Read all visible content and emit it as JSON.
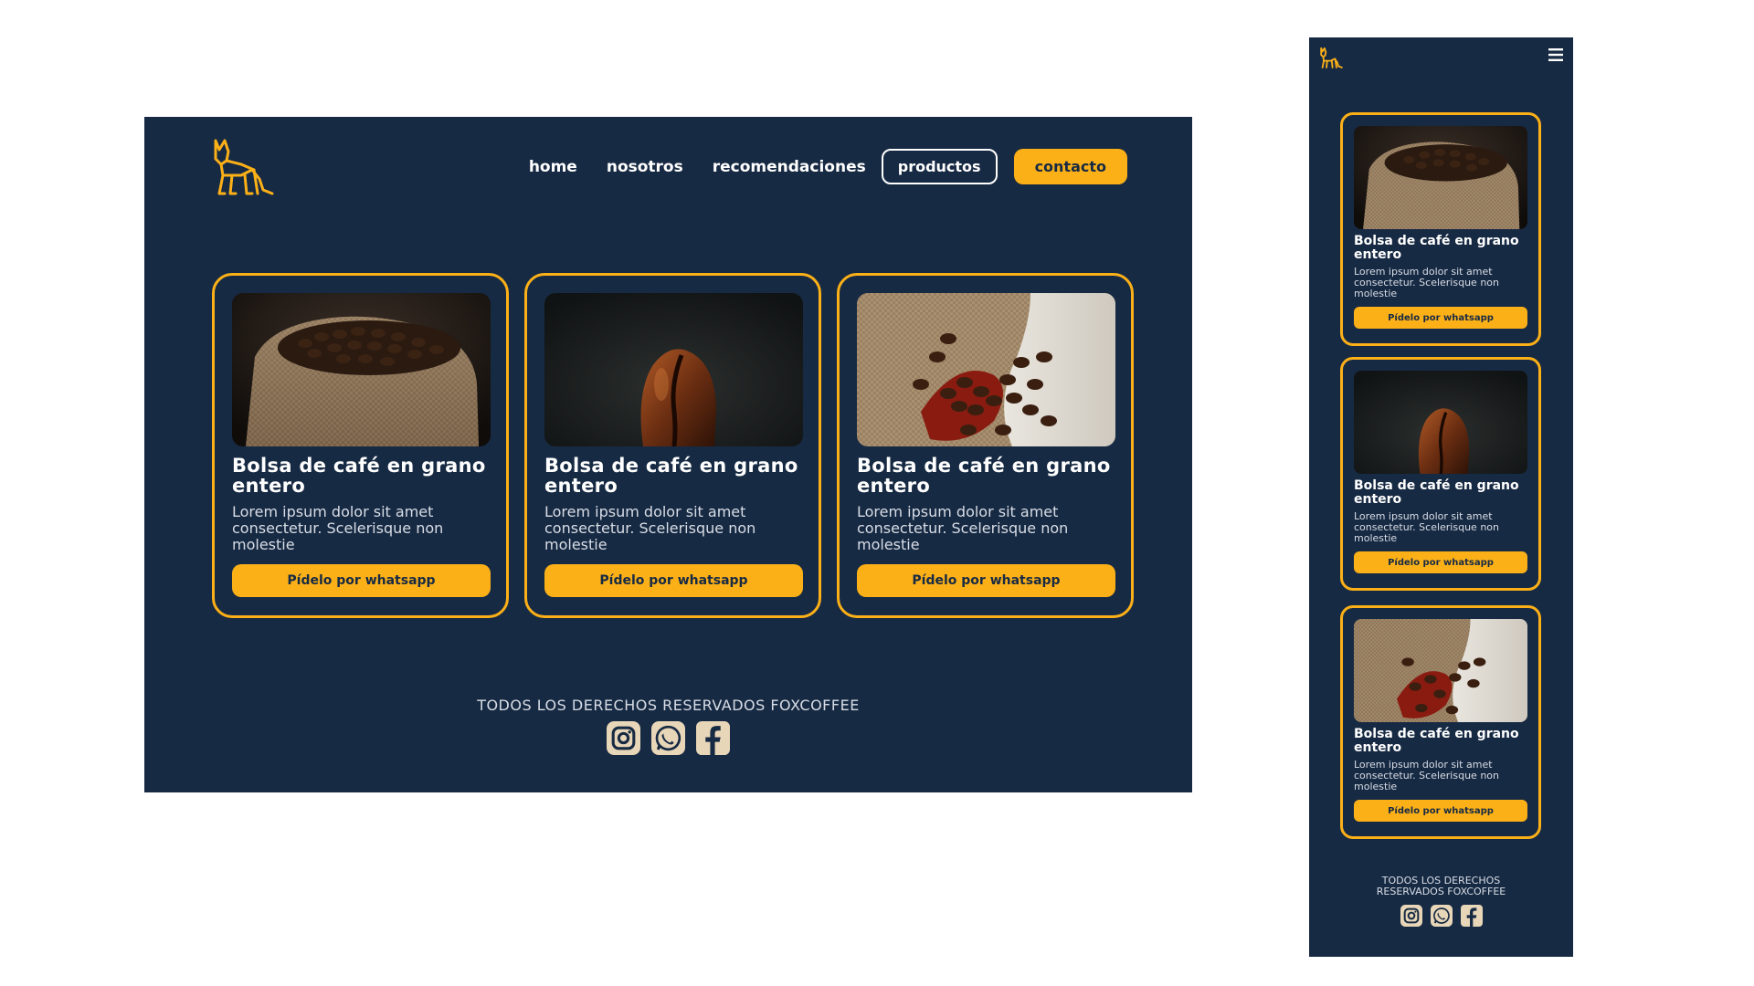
{
  "colors": {
    "background": "#172a43",
    "accent": "#fbb018",
    "text": "#ffffff"
  },
  "brand": {
    "logo_icon": "fox-logo-icon"
  },
  "nav": {
    "home": "home",
    "nosotros": "nosotros",
    "recomendaciones": "recomendaciones",
    "productos": "productos",
    "contacto": "contacto"
  },
  "products": [
    {
      "title": "Bolsa de café en grano entero",
      "description": "Lorem ipsum dolor sit amet consectetur. Scelerisque non molestie",
      "button": "Pídelo por whatsapp",
      "image": "coffee-sack-image"
    },
    {
      "title": "Bolsa de café en grano entero",
      "description": "Lorem ipsum dolor sit amet consectetur. Scelerisque non molestie",
      "button": "Pídelo por whatsapp",
      "image": "coffee-bean-closeup-image"
    },
    {
      "title": "Bolsa de café en grano entero",
      "description": "Lorem ipsum dolor sit amet consectetur. Scelerisque non molestie",
      "button": "Pídelo por whatsapp",
      "image": "coffee-beans-scoop-image"
    }
  ],
  "footer": {
    "copyright": "TODOS LOS DERECHOS RESERVADOS FOXCOFFEE",
    "socials": [
      "instagram-icon",
      "whatsapp-icon",
      "facebook-icon"
    ]
  },
  "mobile": {
    "menu_icon": "hamburger-menu-icon"
  }
}
